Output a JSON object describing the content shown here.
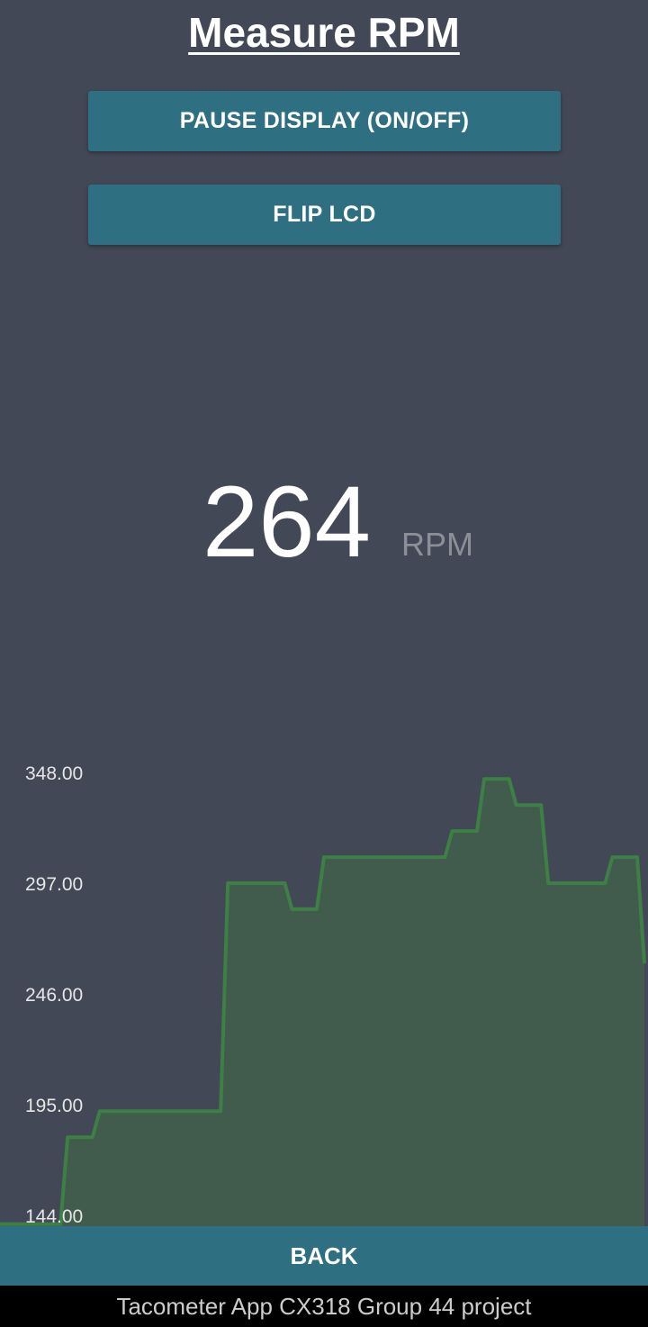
{
  "header": {
    "title": "Measure RPM"
  },
  "controls": {
    "pause_label": "PAUSE DISPLAY (ON/OFF)",
    "flip_label": "FLIP LCD"
  },
  "reading": {
    "value": "264",
    "unit": "RPM"
  },
  "chart_data": {
    "type": "area",
    "step": true,
    "ylim": [
      144,
      348
    ],
    "yticks": [
      "348.00",
      "297.00",
      "246.00",
      "195.00",
      "144.00"
    ],
    "x": [
      0,
      1,
      2,
      3,
      4,
      5,
      6,
      7,
      8,
      9,
      10,
      11,
      12,
      13,
      14,
      15,
      16,
      17,
      18,
      19
    ],
    "values": [
      140,
      140,
      180,
      192,
      192,
      192,
      192,
      297,
      297,
      285,
      309,
      309,
      309,
      309,
      321,
      345,
      333,
      297,
      297,
      309
    ],
    "last_value": 260,
    "colors": {
      "line": "#3d7f44",
      "fill": "#415b4d"
    },
    "grid": false
  },
  "footer": {
    "back_label": "BACK",
    "caption": "Tacometer App CX318 Group 44 project"
  }
}
